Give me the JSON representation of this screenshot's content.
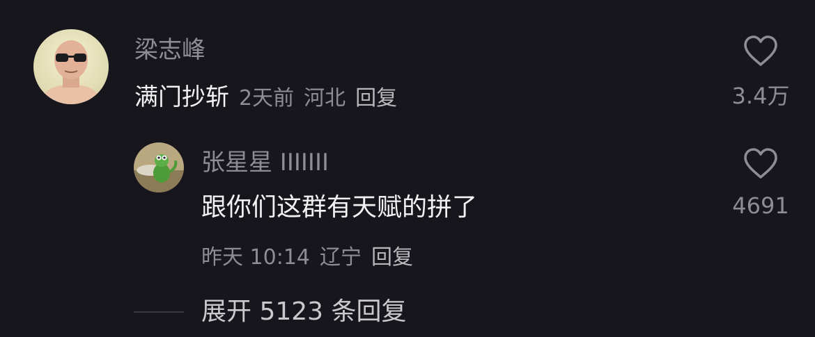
{
  "comment": {
    "username": "梁志峰",
    "text": "满门抄斩",
    "time": "2天前",
    "location": "河北",
    "reply_label": "回复",
    "like_count": "3.4万",
    "avatar_icon": "avatar-man-sunglasses"
  },
  "reply": {
    "username": "张星星 IIIIIII",
    "text": "跟你们这群有天赋的拼了",
    "time": "昨天 10:14",
    "location": "辽宁",
    "reply_label": "回复",
    "like_count": "4691",
    "avatar_icon": "avatar-cartoon-crocodile"
  },
  "expand": {
    "label": "展开 5123 条回复"
  },
  "colors": {
    "background": "#17161d",
    "primary_text": "#f2f2f2",
    "secondary_text": "#8d8d93"
  }
}
